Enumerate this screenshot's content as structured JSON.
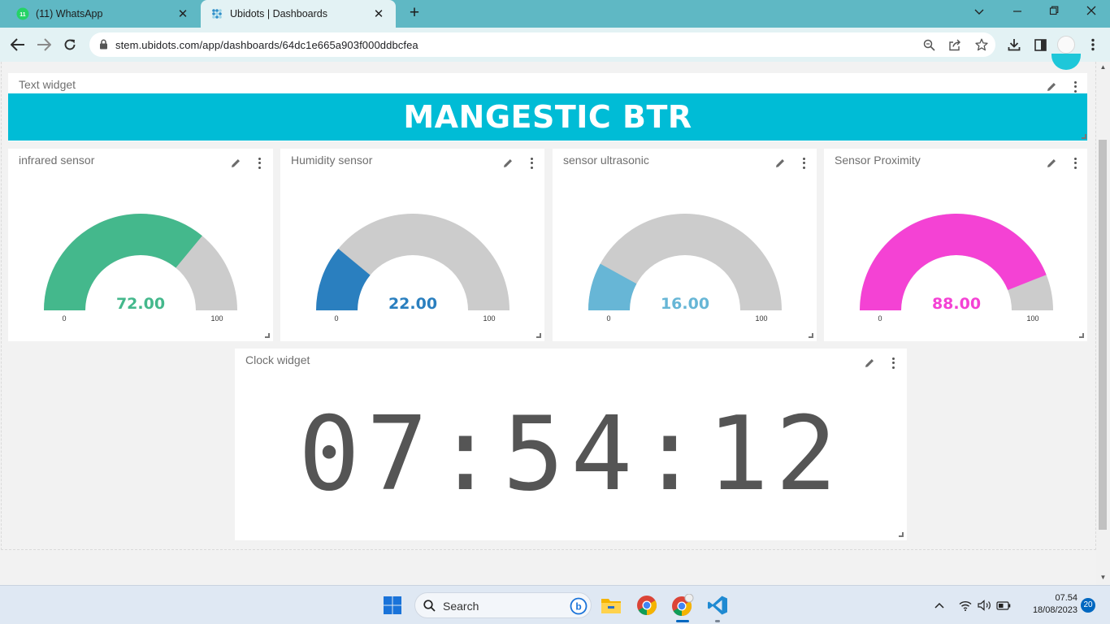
{
  "browser": {
    "tabs": [
      {
        "title": "(11) WhatsApp",
        "favicon": "whatsapp-icon"
      },
      {
        "title": "Ubidots | Dashboards",
        "favicon": "ubidots-icon"
      }
    ],
    "url": "stem.ubidots.com/app/dashboards/64dc1e665a903f000ddbcfea",
    "accent": "#5fb8c4"
  },
  "dashboard": {
    "text_widget": {
      "title": "Text widget",
      "banner": "MANGESTIC BTR",
      "banner_color": "#00bcd6"
    },
    "gauges": [
      {
        "title": "infrared sensor",
        "value": 72,
        "display": "72.00",
        "min_label": "0",
        "max_label": "100",
        "min": 0,
        "max": 100,
        "color": "#44b88c"
      },
      {
        "title": "Humidity sensor",
        "value": 22,
        "display": "22.00",
        "min_label": "0",
        "max_label": "100",
        "min": 0,
        "max": 100,
        "color": "#2a7fbf"
      },
      {
        "title": "sensor ultrasonic",
        "value": 16,
        "display": "16.00",
        "min_label": "0",
        "max_label": "100",
        "min": 0,
        "max": 100,
        "color": "#67b6d6"
      },
      {
        "title": "Sensor Proximity",
        "value": 88,
        "display": "88.00",
        "min_label": "0",
        "max_label": "100",
        "min": 0,
        "max": 100,
        "color": "#f442d4"
      }
    ],
    "gauge_track_color": "#cccccc",
    "clock_widget": {
      "title": "Clock widget",
      "time": "07:54:12"
    }
  },
  "taskbar": {
    "search_placeholder": "Search",
    "time": "07.54",
    "date": "18/08/2023",
    "notifications": "20"
  }
}
